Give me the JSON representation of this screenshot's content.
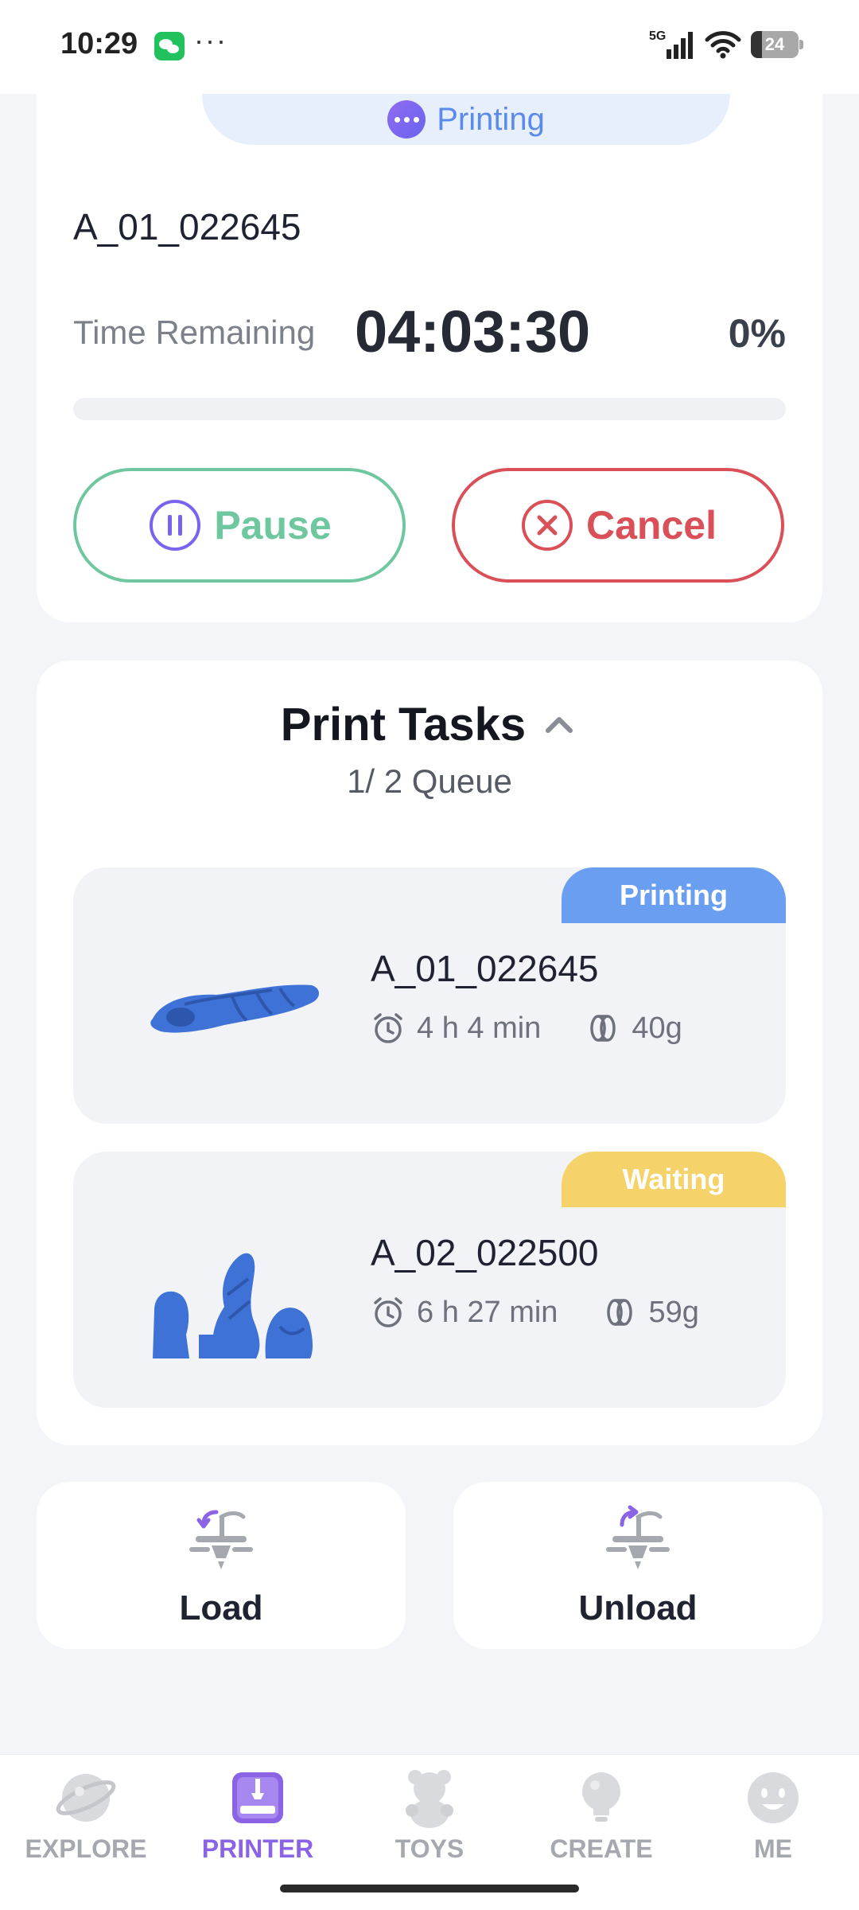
{
  "status_bar": {
    "time": "10:29",
    "more": "···",
    "network": "5G",
    "battery": "24"
  },
  "print_status": {
    "state_label": "Printing",
    "job_name": "A_01_022645",
    "time_remaining_label": "Time Remaining",
    "time_remaining": "04:03:30",
    "progress_percent_label": "0%",
    "progress_fraction": 0,
    "pause_label": "Pause",
    "cancel_label": "Cancel",
    "colors": {
      "accent": "#5a8bea",
      "pause": "#6fc7a0",
      "cancel": "#da5059"
    }
  },
  "tasks": {
    "title": "Print Tasks",
    "queue": "1/ 2 Queue",
    "items": [
      {
        "name": "A_01_022645",
        "badge": "Printing",
        "duration": "4 h 4 min",
        "weight": "40g",
        "badge_color": "#6a9ef0"
      },
      {
        "name": "A_02_022500",
        "badge": "Waiting",
        "duration": "6 h 27 min",
        "weight": "59g",
        "badge_color": "#f6d26a"
      }
    ]
  },
  "actions": {
    "load_label": "Load",
    "unload_label": "Unload"
  },
  "nav": {
    "items": [
      {
        "label": "EXPLORE",
        "icon": "planet-icon"
      },
      {
        "label": "PRINTER",
        "icon": "printer-icon",
        "active": true
      },
      {
        "label": "TOYS",
        "icon": "teddy-icon"
      },
      {
        "label": "CREATE",
        "icon": "lightbulb-icon"
      },
      {
        "label": "ME",
        "icon": "smiley-icon"
      }
    ]
  }
}
